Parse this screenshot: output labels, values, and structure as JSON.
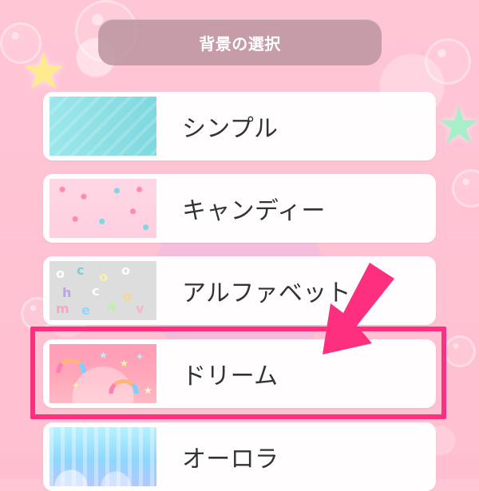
{
  "header": {
    "title": "背景の選択"
  },
  "backgrounds": [
    {
      "label": "シンプル",
      "thumbnail": "simple-thumbnail"
    },
    {
      "label": "キャンディー",
      "thumbnail": "candy-thumbnail"
    },
    {
      "label": "アルファベット",
      "thumbnail": "alphabet-thumbnail"
    },
    {
      "label": "ドリーム",
      "thumbnail": "dream-thumbnail"
    },
    {
      "label": "オーロラ",
      "thumbnail": "aurora-thumbnail"
    }
  ],
  "highlight": {
    "selected_label": "ドリーム",
    "color": "#ff2f7f"
  },
  "colors": {
    "background": "#ffc6d6",
    "title_pill": "#bc95a1",
    "highlight": "#ff2f7f"
  }
}
